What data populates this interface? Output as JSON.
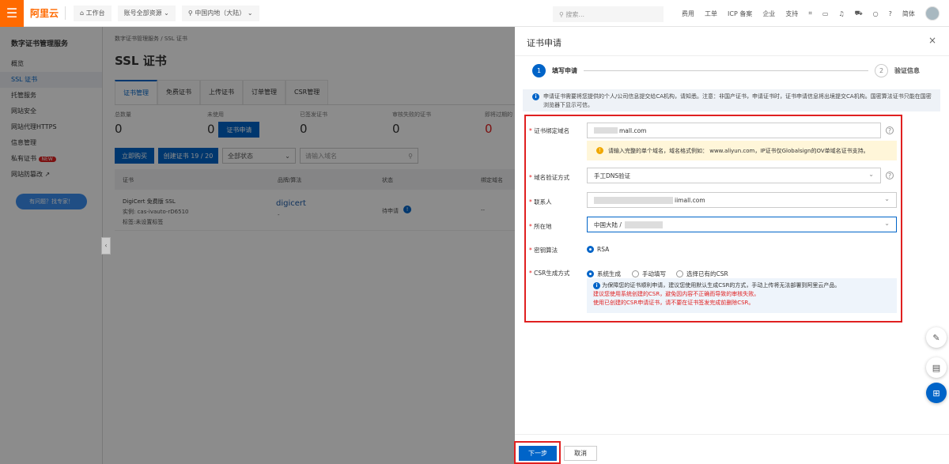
{
  "topbar": {
    "logo": "阿里云",
    "workbench": "工作台",
    "resources": "账号全部资源",
    "region": "中国内地（大陆）",
    "search_placeholder": "搜索...",
    "links": [
      "费用",
      "工单",
      "ICP 备案",
      "企业",
      "支持"
    ],
    "lang": "简体"
  },
  "sidebar": {
    "title": "数字证书管理服务",
    "items": [
      {
        "label": "概览"
      },
      {
        "label": "SSL 证书"
      },
      {
        "label": "托管服务"
      },
      {
        "label": "网站安全"
      },
      {
        "label": "网站代理HTTPS"
      },
      {
        "label": "信息管理"
      },
      {
        "label": "私有证书",
        "badge": "NEW"
      },
      {
        "label": "网站防篡改"
      }
    ],
    "help": "有问题？找专家！"
  },
  "main": {
    "breadcrumb": [
      "数字证书管理服务",
      "SSL 证书"
    ],
    "title": "SSL 证书",
    "tabs": [
      "证书管理",
      "免费证书",
      "上传证书",
      "订单管理",
      "CSR管理"
    ],
    "stats": [
      {
        "label": "总数量",
        "value": "0"
      },
      {
        "label": "未使用",
        "value": "0"
      },
      {
        "label": "已签发证书",
        "value": "0"
      },
      {
        "label": "审核失败的证书",
        "value": "0"
      },
      {
        "label": "即将过期的",
        "value": "0"
      }
    ],
    "apply_btn": "证书申请",
    "buy_btn": "立即购买",
    "create_btn": "创建证书 19 / 20",
    "status_filter": "全部状态",
    "domain_placeholder": "请输入域名",
    "columns": [
      "证书",
      "品牌/算法",
      "状态",
      "绑定域名"
    ],
    "rows": [
      {
        "name": "DigiCert 免费版 SSL",
        "instance": "实例: cas-ivauto-rD6510",
        "tag": "标签:未设置标签",
        "brand": "digicert",
        "algo": "-",
        "status": "待申请",
        "domain": "--"
      }
    ]
  },
  "drawer": {
    "title": "证书申请",
    "steps": [
      {
        "num": "1",
        "label": "填写申请"
      },
      {
        "num": "2",
        "label": "验证信息"
      }
    ],
    "info": "申请证书需要将您提供的个人/公司信息提交给CA机构，请知悉。注意：非国产证书，申请证书时，证书申请信息将出境提交CA机构。国密算法证书只能在国密浏览器下显示可信。",
    "fields": {
      "domain_label": "证书绑定域名",
      "domain_value": "mall.com",
      "domain_warning": "请输入完整的单个域名，域名格式例如： www.aliyun.com，IP证书仅Globalsign的OV单域名证书支持。",
      "verify_label": "域名验证方式",
      "verify_value": "手工DNS验证",
      "contact_label": "联系人",
      "contact_value": "iimall.com",
      "location_label": "所在地",
      "location_value": "中国大陆 /",
      "algo_label": "密钥算法",
      "algo_value": "RSA",
      "csr_label": "CSR生成方式",
      "csr_options": [
        "系统生成",
        "手动填写",
        "选择已有的CSR"
      ],
      "csr_info": "为保障您的证书顺利申请，建议您使用默认生成CSR的方式，手动上传将无法部署到阿里云产品。",
      "csr_warn1": "建议您使用系统创建的CSR，避免因内容不正确而导致的审核失败。",
      "csr_warn2": "使用已创建的CSR申请证书，请不要在证书签发完成前删除CSR。"
    },
    "next": "下一步",
    "cancel": "取消"
  },
  "colors": {
    "accent": "#0064c8",
    "brand": "#ff6a00",
    "highlight": "#e02020"
  }
}
